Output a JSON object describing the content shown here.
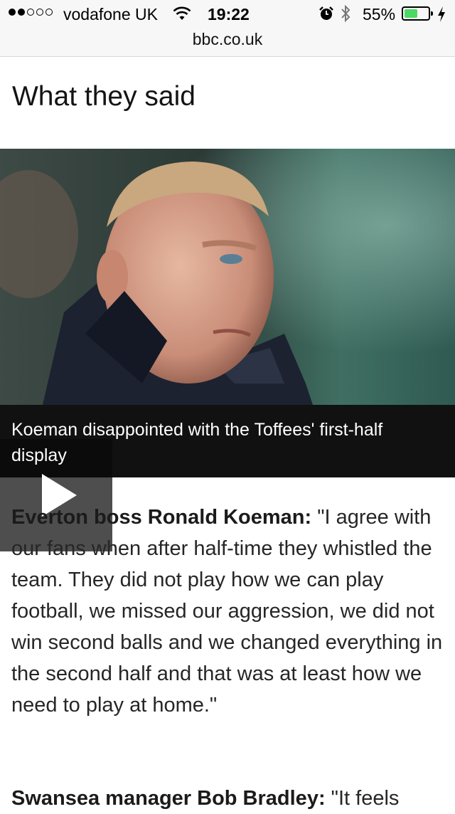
{
  "status_bar": {
    "carrier": "vodafone UK",
    "time": "19:22",
    "battery_percent": "55%",
    "battery_level": 0.55,
    "signal_bars": 2,
    "icons": [
      "wifi-icon",
      "alarm-icon",
      "bluetooth-icon",
      "battery-icon",
      "charging-icon"
    ]
  },
  "browser": {
    "url": "bbc.co.uk"
  },
  "article": {
    "section_title": "What they said",
    "video": {
      "caption": "Koeman disappointed with the Toffees' first-half display",
      "icon": "play-icon"
    },
    "quotes": [
      {
        "speaker": "Everton boss Ronald Koeman:",
        "text": " \"I agree with our fans when after half-time they whistled the team. They did not play how we can play football, we missed our aggression, we did not win second balls and we changed everything in the second half and that was at least how we need to play at home.\""
      },
      {
        "speaker": "Swansea manager Bob Bradley:",
        "text": " \"It feels"
      }
    ]
  },
  "colors": {
    "status_bar_bg": "#f7f7f7",
    "battery_fill": "#4cd964",
    "caption_bg": "#111111"
  }
}
